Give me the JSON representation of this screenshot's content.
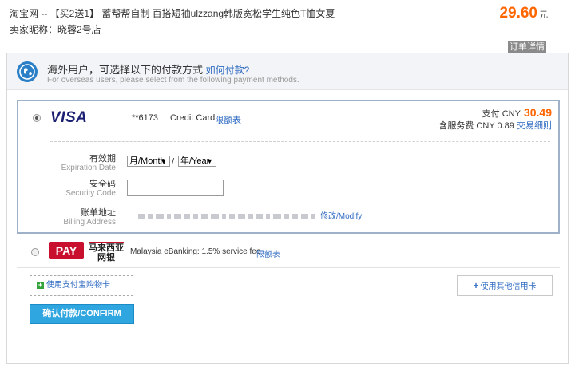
{
  "order": {
    "title": "淘宝网 -- 【买2送1】 蓄帮帮自制 百搭短袖ulzzang韩版宽松学生纯色T恤女夏",
    "seller": "卖家昵称：晓蓉2号店",
    "price": "29.60",
    "currency_unit": "元",
    "details_tab": "订单详情"
  },
  "info": {
    "title": "海外用户，可选择以下的付款方式",
    "how_to_pay": "如何付款?",
    "subtitle": "For overseas users, please select from the following payment methods."
  },
  "visa": {
    "logo": "VISA",
    "card_number": "**6173",
    "card_type": "Credit Card",
    "limit_link": "限额表",
    "pay_label": "支付 CNY",
    "pay_amount": "30.49",
    "fee_text": "含服务费 CNY 0.89",
    "fee_link": "交易细则",
    "expiration": {
      "label_cn": "有效期",
      "label_en": "Expiration Date",
      "month": "月/Month",
      "year": "年/Year"
    },
    "security": {
      "label_cn": "安全码",
      "label_en": "Security Code"
    },
    "billing": {
      "label_cn": "账单地址",
      "label_en": "Billing Address",
      "modify_link": "修改/Modify"
    }
  },
  "molpay": {
    "logo": "PAY",
    "sub_cn_line1": "马来西亚",
    "sub_cn_line2": "网银",
    "description": "Malaysia eBanking: 1.5% service fee",
    "limit_link": "限额表"
  },
  "actions": {
    "giftcard": "使用支付宝购物卡",
    "other_card": "使用其他信用卡",
    "confirm": "确认付款/CONFIRM"
  },
  "colors": {
    "accent_orange": "#ff6600",
    "link_blue": "#2f6bc1",
    "confirm_blue": "#2fa6e0",
    "card_border": "#9fb1c8"
  }
}
